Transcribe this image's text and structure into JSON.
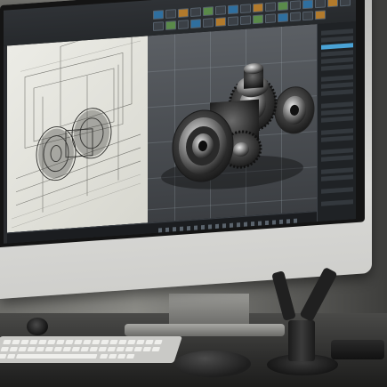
{
  "scene": {
    "description_free": true,
    "colors": {
      "screen_dark": "#2a2c2f",
      "accent_blue": "#4aa3d6",
      "sketch_paper": "#ecece6"
    }
  },
  "cad_app": {
    "ribbon_tabs": [
      "",
      "",
      "",
      "",
      ""
    ]
  }
}
